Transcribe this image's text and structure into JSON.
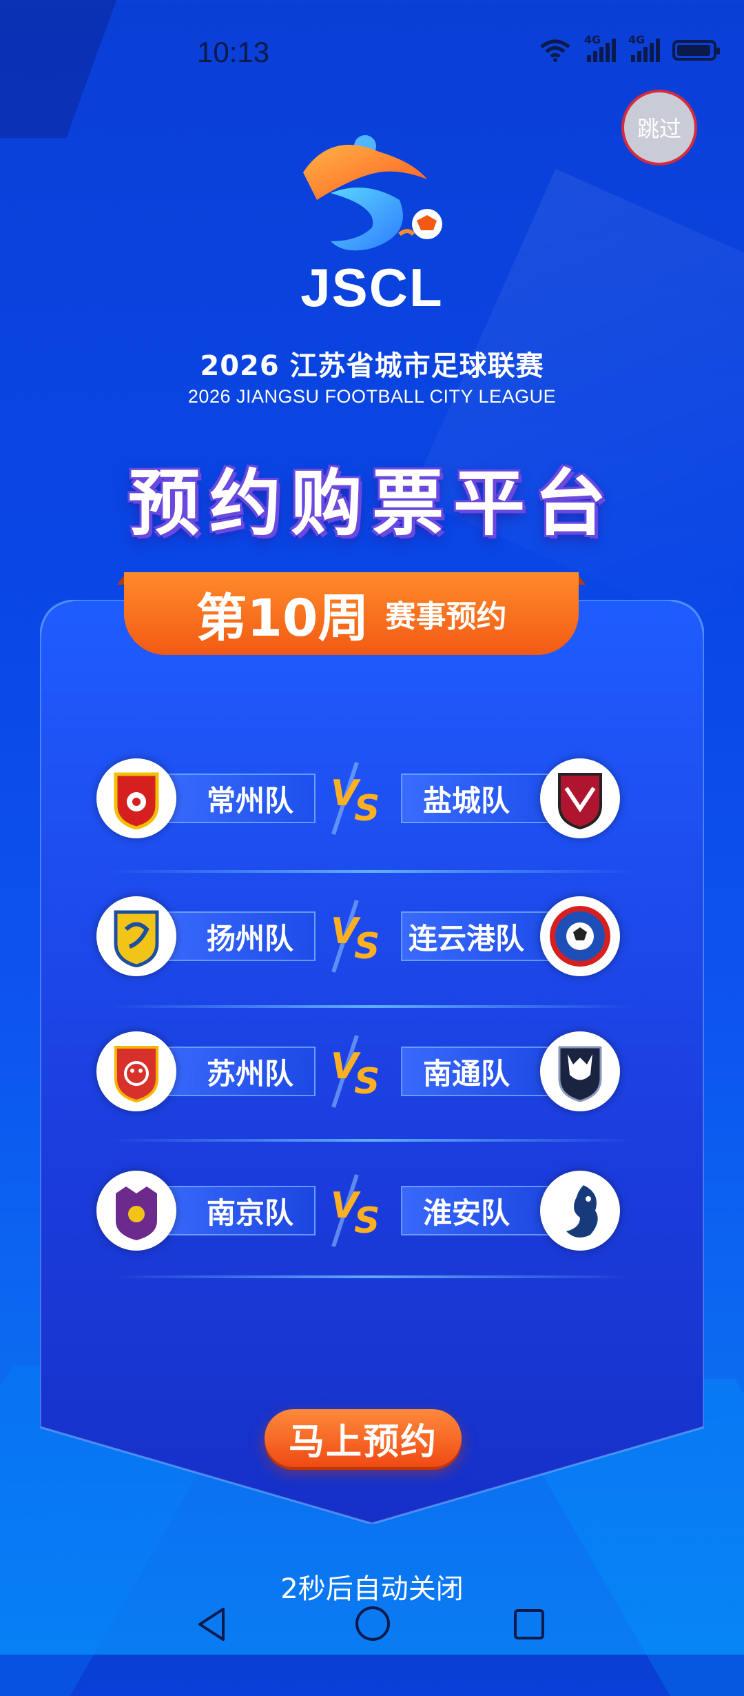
{
  "status_bar": {
    "time": "10:13",
    "signal1": "4G",
    "signal2": "4G"
  },
  "skip_label": "跳过",
  "logo_text": "JSCL",
  "league": {
    "title_cn": "2026 江苏省城市足球联赛",
    "title_en": "2026 JIANGSU FOOTBALL CITY LEAGUE"
  },
  "main_title": "预约购票平台",
  "week": {
    "label": "第10周",
    "sublabel": "赛事预约"
  },
  "vs_text": "VS",
  "matches": [
    {
      "home": "常州队",
      "away": "盐城队"
    },
    {
      "home": "扬州队",
      "away": "连云港队"
    },
    {
      "home": "苏州队",
      "away": "南通队"
    },
    {
      "home": "南京队",
      "away": "淮安队"
    }
  ],
  "cta_label": "马上预约",
  "auto_close": "2秒后自动关闭",
  "colors": {
    "accent_orange": "#f25a14",
    "primary_blue": "#0a46e6"
  }
}
